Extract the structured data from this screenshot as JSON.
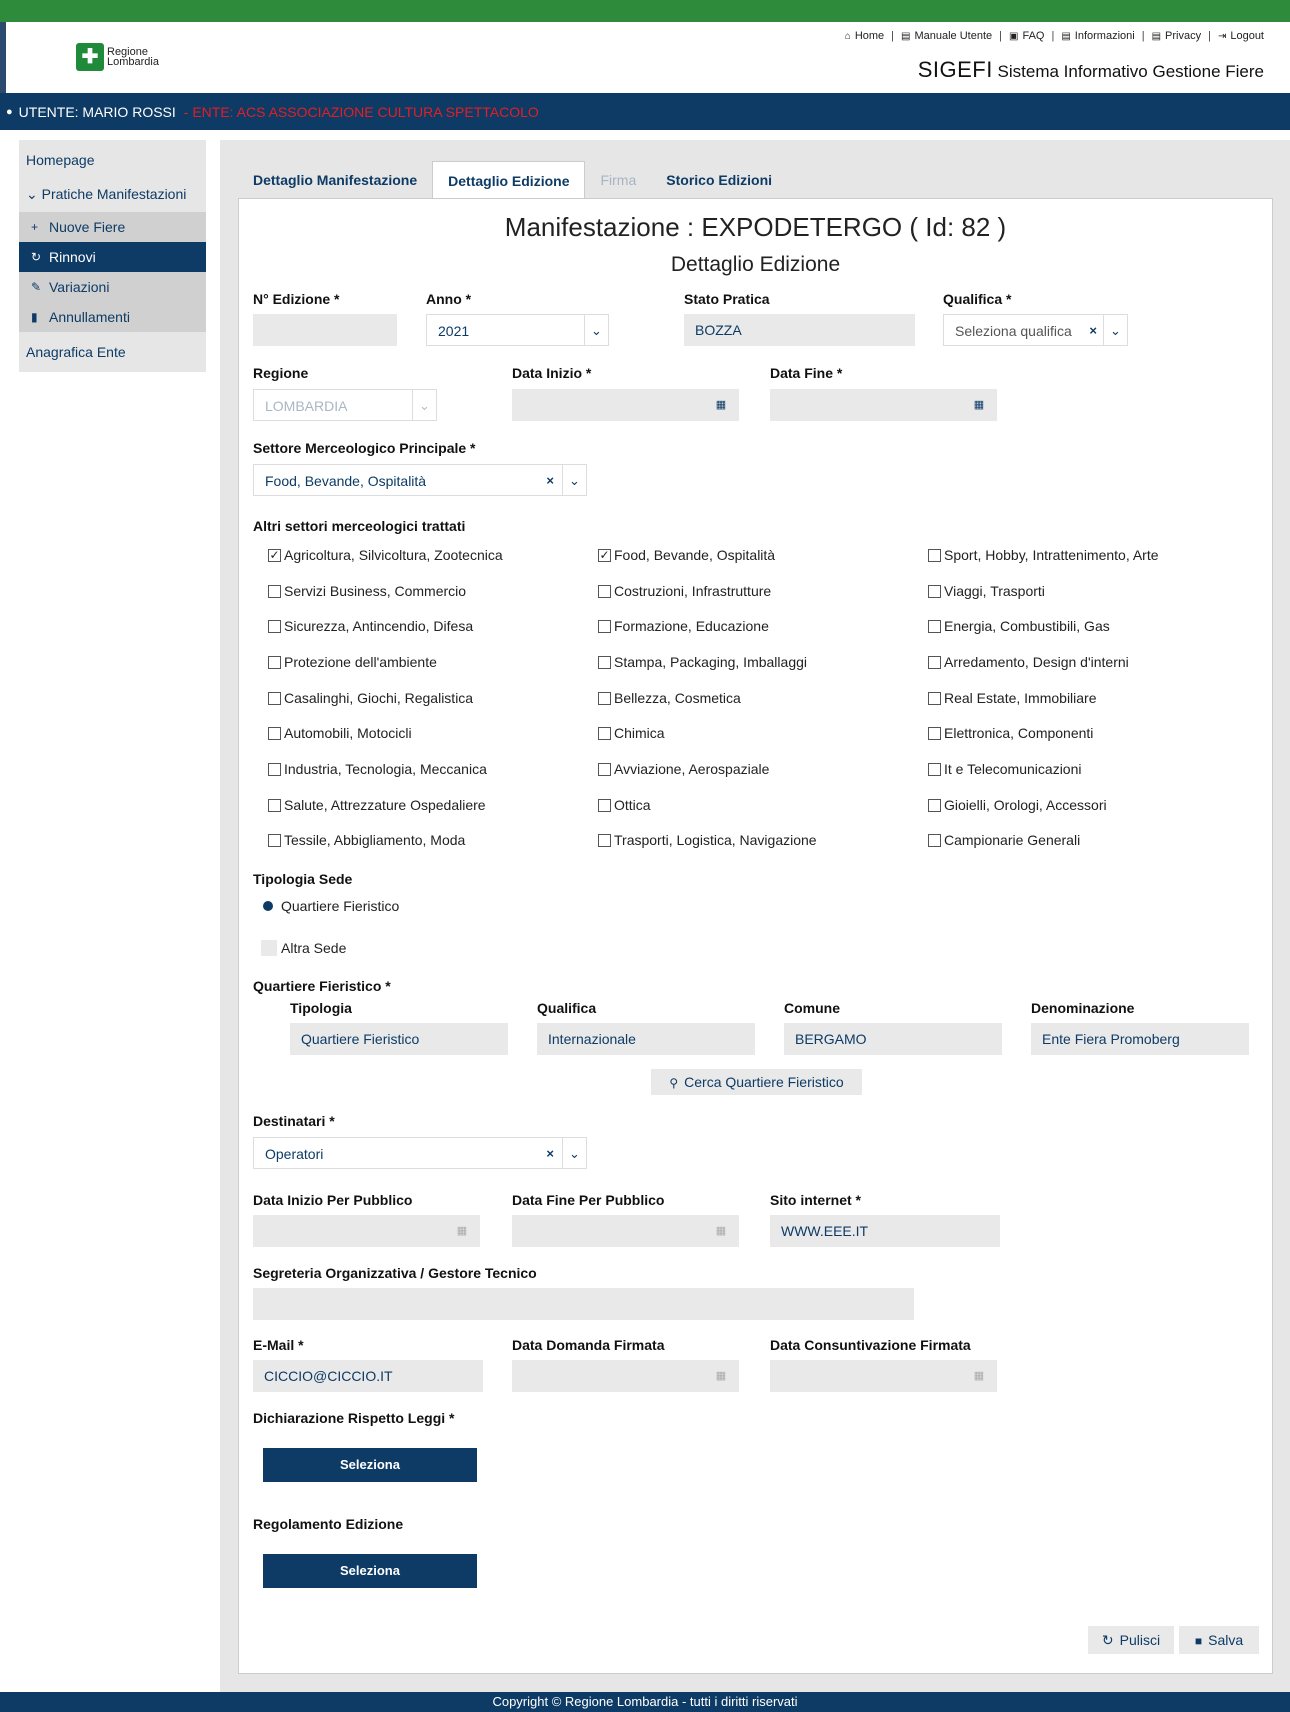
{
  "header": {
    "logo_line1": "Regione",
    "logo_line2": "Lombardia",
    "links": [
      "Home",
      "Manuale Utente",
      "FAQ",
      "Informazioni",
      "Privacy",
      "Logout"
    ],
    "sys_short": "SIGEFI",
    "sys_long": "Sistema Informativo Gestione Fiere"
  },
  "userbar": {
    "user": "UTENTE: MARIO ROSSI",
    "ente": "- ENTE: ACS ASSOCIAZIONE CULTURA SPETTACOLO"
  },
  "sidebar": {
    "homepage": "Homepage",
    "pratiche": "Pratiche Manifestazioni",
    "nuove": "Nuove Fiere",
    "rinnovi": "Rinnovi",
    "variazioni": "Variazioni",
    "annullamenti": "Annullamenti",
    "anagrafica": "Anagrafica Ente"
  },
  "tabs": [
    "Dettaglio Manifestazione",
    "Dettaglio Edizione",
    "Firma",
    "Storico Edizioni"
  ],
  "title": "Manifestazione : EXPODETERGO ( Id: 82 )",
  "subtitle": "Dettaglio Edizione",
  "form": {
    "n_edizione_label": "N° Edizione *",
    "n_edizione_value": "",
    "anno_label": "Anno *",
    "anno_value": "2021",
    "stato_label": "Stato Pratica",
    "stato_value": "BOZZA",
    "qualifica_label": "Qualifica *",
    "qualifica_value": "Seleziona qualifica",
    "regione_label": "Regione",
    "regione_value": "LOMBARDIA",
    "data_inizio_label": "Data Inizio *",
    "data_fine_label": "Data Fine *",
    "settore_label": "Settore Merceologico Principale *",
    "settore_value": "Food, Bevande, Ospitalità",
    "altri_label": "Altri settori merceologici trattati",
    "settori": [
      {
        "label": "Agricoltura, Silvicoltura, Zootecnica",
        "checked": true
      },
      {
        "label": "Food, Bevande, Ospitalità",
        "checked": true
      },
      {
        "label": "Sport, Hobby, Intrattenimento, Arte",
        "checked": false
      },
      {
        "label": "Servizi Business, Commercio",
        "checked": false
      },
      {
        "label": "Costruzioni, Infrastrutture",
        "checked": false
      },
      {
        "label": "Viaggi, Trasporti",
        "checked": false
      },
      {
        "label": "Sicurezza, Antincendio, Difesa",
        "checked": false
      },
      {
        "label": "Formazione, Educazione",
        "checked": false
      },
      {
        "label": "Energia, Combustibili, Gas",
        "checked": false
      },
      {
        "label": "Protezione dell'ambiente",
        "checked": false
      },
      {
        "label": "Stampa, Packaging, Imballaggi",
        "checked": false
      },
      {
        "label": "Arredamento, Design d'interni",
        "checked": false
      },
      {
        "label": "Casalinghi, Giochi, Regalistica",
        "checked": false
      },
      {
        "label": "Bellezza, Cosmetica",
        "checked": false
      },
      {
        "label": "Real Estate, Immobiliare",
        "checked": false
      },
      {
        "label": "Automobili, Motocicli",
        "checked": false
      },
      {
        "label": "Chimica",
        "checked": false
      },
      {
        "label": "Elettronica, Componenti",
        "checked": false
      },
      {
        "label": "Industria, Tecnologia, Meccanica",
        "checked": false
      },
      {
        "label": "Avviazione, Aerospaziale",
        "checked": false
      },
      {
        "label": "It e Telecomunicazioni",
        "checked": false
      },
      {
        "label": "Salute, Attrezzature Ospedaliere",
        "checked": false
      },
      {
        "label": "Ottica",
        "checked": false
      },
      {
        "label": "Gioielli, Orologi, Accessori",
        "checked": false
      },
      {
        "label": "Tessile, Abbigliamento, Moda",
        "checked": false
      },
      {
        "label": "Trasporti, Logistica, Navigazione",
        "checked": false
      },
      {
        "label": "Campionarie Generali",
        "checked": false
      }
    ],
    "tipologia_sede_label": "Tipologia Sede",
    "sede_opt1": "Quartiere Fieristico",
    "sede_opt2": "Altra Sede",
    "quartiere_label": "Quartiere Fieristico *",
    "q_tipologia_label": "Tipologia",
    "q_tipologia_value": "Quartiere Fieristico",
    "q_qualifica_label": "Qualifica",
    "q_qualifica_value": "Internazionale",
    "q_comune_label": "Comune",
    "q_comune_value": "BERGAMO",
    "q_denominazione_label": "Denominazione",
    "q_denominazione_value": "Ente Fiera Promoberg",
    "cerca_button": "Cerca Quartiere Fieristico",
    "destinatari_label": "Destinatari *",
    "destinatari_value": "Operatori",
    "data_inizio_pub_label": "Data Inizio Per Pubblico",
    "data_fine_pub_label": "Data Fine Per Pubblico",
    "sito_label": "Sito internet *",
    "sito_value": "WWW.EEE.IT",
    "segreteria_label": "Segreteria Organizzativa / Gestore Tecnico",
    "email_label": "E-Mail *",
    "email_value": "CICCIO@CICCIO.IT",
    "data_domanda_label": "Data Domanda Firmata",
    "data_consuntivo_label": "Data Consuntivazione Firmata",
    "dichiarazione_label": "Dichiarazione Rispetto Leggi *",
    "regolamento_label": "Regolamento Edizione",
    "seleziona": "Seleziona",
    "pulisci": "Pulisci",
    "salva": "Salva"
  },
  "footer": "Copyright © Regione Lombardia - tutti i diritti riservati",
  "colors": {
    "primary": "#0d3b66",
    "green": "#2e8b3c",
    "ente_red": "#e31e24",
    "field_bg": "#e9e9e9"
  }
}
